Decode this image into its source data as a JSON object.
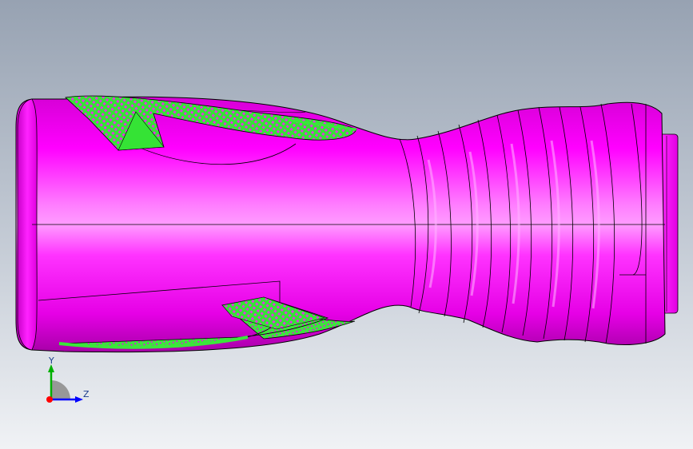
{
  "viewport": {
    "background_top": "#9aa5b4",
    "background_bottom": "#eceff3"
  },
  "model": {
    "body_color": "#ff00ff",
    "body_highlight": "#ff9cff",
    "body_shadow": "#b000b0",
    "feature_face_color": "#3be63b",
    "edge_color": "#000000"
  },
  "triad": {
    "y_label": "Y",
    "z_label": "Z",
    "y_axis_color": "#00b000",
    "z_axis_color": "#0000ff",
    "x_axis_color": "#ff0000"
  }
}
